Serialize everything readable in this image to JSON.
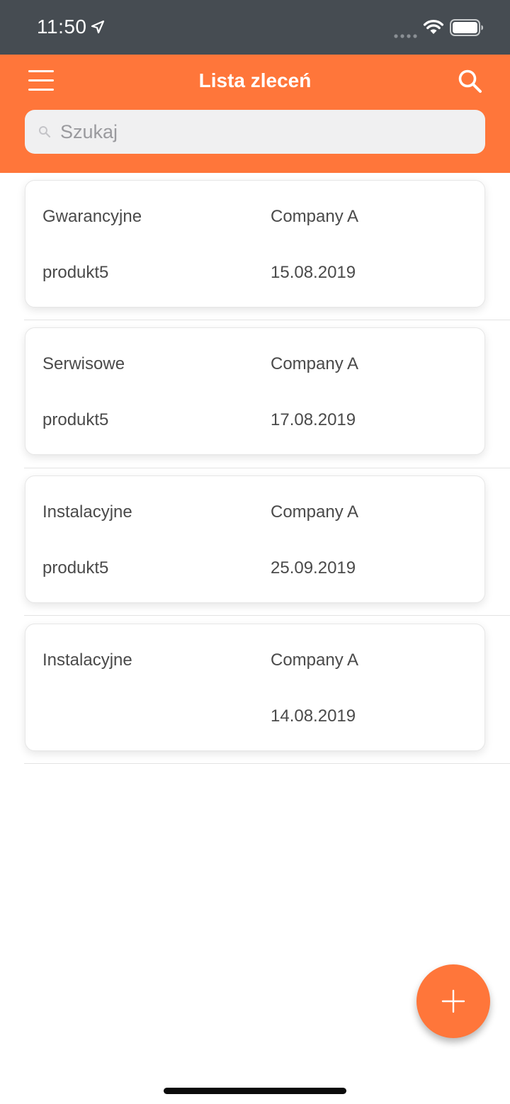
{
  "status_bar": {
    "time": "11:50",
    "icons": [
      "location-arrow-icon",
      "signal-dots-icon",
      "wifi-icon",
      "battery-icon"
    ]
  },
  "header": {
    "title": "Lista zleceń",
    "menu_icon": "hamburger-menu-icon",
    "search_icon": "search-icon",
    "background_color": "#ff763a"
  },
  "search": {
    "placeholder": "Szukaj",
    "value": ""
  },
  "orders": [
    {
      "type": "Gwarancyjne",
      "company": "Company A",
      "product": "produkt5",
      "date": "15.08.2019"
    },
    {
      "type": "Serwisowe",
      "company": "Company A",
      "product": "produkt5",
      "date": "17.08.2019"
    },
    {
      "type": "Instalacyjne",
      "company": "Company A",
      "product": "produkt5",
      "date": "25.09.2019"
    },
    {
      "type": "Instalacyjne",
      "company": "Company A",
      "product": "",
      "date": "14.08.2019"
    }
  ],
  "fab": {
    "icon": "plus-icon",
    "color": "#ff763a"
  }
}
